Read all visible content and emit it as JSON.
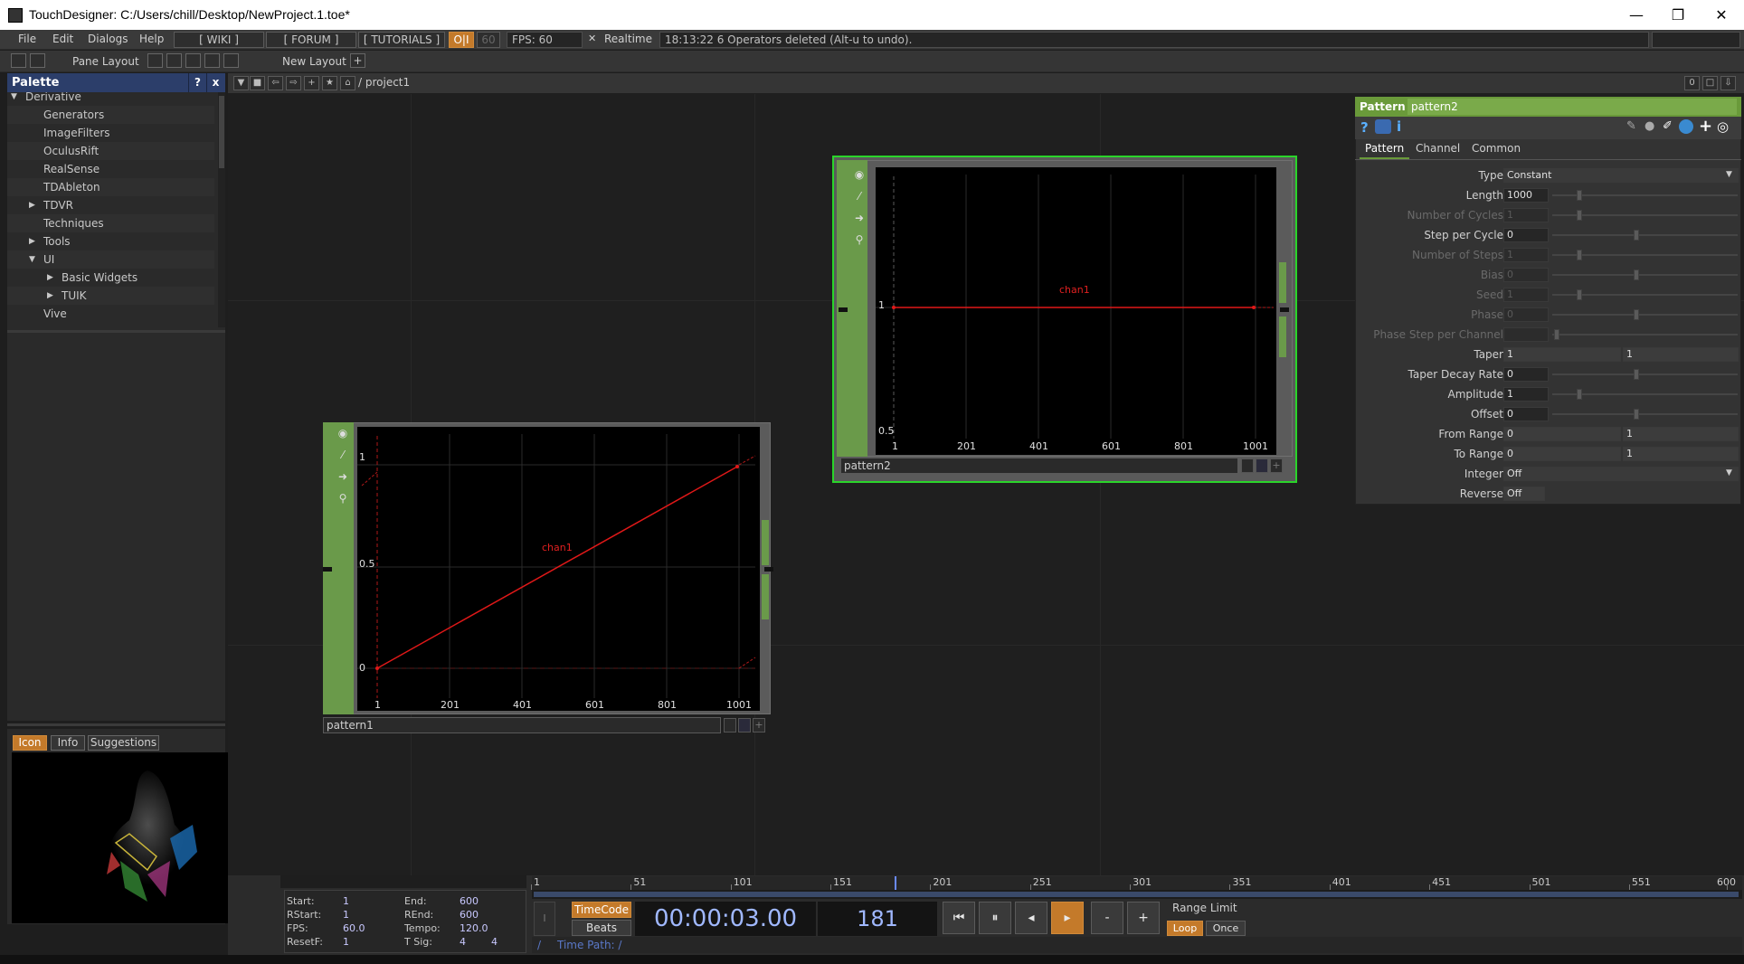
{
  "window": {
    "title": "TouchDesigner: C:/Users/chill/Desktop/NewProject.1.toe*",
    "minimize": "—",
    "maximize": "❐",
    "close": "✕"
  },
  "menubar": {
    "file": "File",
    "edit": "Edit",
    "dialogs": "Dialogs",
    "help": "Help",
    "wiki": "[ WIKI ]",
    "forum": "[ FORUM ]",
    "tutorials": "[ TUTORIALS ]",
    "oi": "O|I",
    "fps_cap": "60",
    "fps": "FPS:  60",
    "realtime_box": "✕",
    "realtime": "Realtime",
    "status": "18:13:22 6 Operators deleted (Alt-u to undo)."
  },
  "panebar": {
    "pane_layout": "Pane Layout",
    "new_layout": "New Layout",
    "add": "+"
  },
  "palette": {
    "title": "Palette",
    "help": "?",
    "close": "x",
    "items": [
      {
        "label": "Derivative",
        "indent": 0,
        "arrow": "▼"
      },
      {
        "label": "Generators",
        "indent": 2,
        "arrow": ""
      },
      {
        "label": "ImageFilters",
        "indent": 2,
        "arrow": ""
      },
      {
        "label": "OculusRift",
        "indent": 2,
        "arrow": ""
      },
      {
        "label": "RealSense",
        "indent": 2,
        "arrow": ""
      },
      {
        "label": "TDAbleton",
        "indent": 2,
        "arrow": ""
      },
      {
        "label": "TDVR",
        "indent": 2,
        "arrow": "▶"
      },
      {
        "label": "Techniques",
        "indent": 2,
        "arrow": ""
      },
      {
        "label": "Tools",
        "indent": 2,
        "arrow": "▶"
      },
      {
        "label": "UI",
        "indent": 2,
        "arrow": "▼"
      },
      {
        "label": "Basic Widgets",
        "indent": 4,
        "arrow": "▶"
      },
      {
        "label": "TUIK",
        "indent": 4,
        "arrow": "▶"
      },
      {
        "label": "Vive",
        "indent": 2,
        "arrow": ""
      }
    ]
  },
  "iconpanel": {
    "tab_icon": "Icon",
    "tab_info": "Info",
    "tab_suggestions": "Suggestions"
  },
  "network": {
    "path": "/ project1",
    "zero": "0"
  },
  "node1": {
    "name": "pattern1",
    "channel": "chan1",
    "x_ticks": [
      "1",
      "201",
      "401",
      "601",
      "801",
      "1001"
    ],
    "y_ticks": [
      "1",
      "0.5",
      "0"
    ]
  },
  "node2": {
    "name": "pattern2",
    "channel": "chan1",
    "x_ticks": [
      "1",
      "201",
      "401",
      "601",
      "801",
      "1001"
    ],
    "y_ticks": [
      "1",
      "0.5"
    ]
  },
  "params": {
    "op_type": "Pattern",
    "op_name": "pattern2",
    "tabs": [
      "Pattern",
      "Channel",
      "Common"
    ],
    "rows": [
      {
        "label": "Type",
        "v1": "Constant",
        "v2": "",
        "dim": false,
        "kind": "menu"
      },
      {
        "label": "Length",
        "v1": "1000",
        "v2": "",
        "dim": false,
        "kind": "slider"
      },
      {
        "label": "Number of Cycles",
        "v1": "1",
        "v2": "",
        "dim": true,
        "kind": "slider"
      },
      {
        "label": "Step per Cycle",
        "v1": "0",
        "v2": "",
        "dim": false,
        "kind": "slider"
      },
      {
        "label": "Number of Steps",
        "v1": "1",
        "v2": "",
        "dim": true,
        "kind": "slider"
      },
      {
        "label": "Bias",
        "v1": "0",
        "v2": "",
        "dim": true,
        "kind": "slider"
      },
      {
        "label": "Seed",
        "v1": "1",
        "v2": "",
        "dim": true,
        "kind": "slider"
      },
      {
        "label": "Phase",
        "v1": "0",
        "v2": "",
        "dim": true,
        "kind": "slider"
      },
      {
        "label": "Phase Step per Channel",
        "v1": "",
        "v2": "",
        "dim": true,
        "kind": "slider"
      },
      {
        "label": "Taper",
        "v1": "1",
        "v2": "1",
        "dim": false,
        "kind": "pair"
      },
      {
        "label": "Taper Decay Rate",
        "v1": "0",
        "v2": "",
        "dim": false,
        "kind": "slider"
      },
      {
        "label": "Amplitude",
        "v1": "1",
        "v2": "",
        "dim": false,
        "kind": "slider"
      },
      {
        "label": "Offset",
        "v1": "0",
        "v2": "",
        "dim": false,
        "kind": "slider"
      },
      {
        "label": "From Range",
        "v1": "0",
        "v2": "1",
        "dim": false,
        "kind": "pair"
      },
      {
        "label": "To Range",
        "v1": "0",
        "v2": "1",
        "dim": false,
        "kind": "pair"
      },
      {
        "label": "Integer",
        "v1": "Off",
        "v2": "",
        "dim": false,
        "kind": "menu"
      },
      {
        "label": "Reverse",
        "v1": "Off",
        "v2": "",
        "dim": false,
        "kind": "toggle"
      }
    ]
  },
  "timeline": {
    "start_lbl": "Start:",
    "start": "1",
    "end_lbl": "End:",
    "end": "600",
    "rstart_lbl": "RStart:",
    "rstart": "1",
    "rend_lbl": "REnd:",
    "rend": "600",
    "fps_lbl": "FPS:",
    "fps": "60.0",
    "tempo_lbl": "Tempo:",
    "tempo": "120.0",
    "resetf_lbl": "ResetF:",
    "resetf": "1",
    "tsig_lbl": "T Sig:",
    "tsig_a": "4",
    "tsig_b": "4",
    "ruler": [
      "1",
      "51",
      "101",
      "151",
      "201",
      "251",
      "301",
      "351",
      "401",
      "451",
      "501",
      "551",
      "600"
    ],
    "timecode_btn": "TimeCode",
    "beats_btn": "Beats",
    "timecode": "00:00:03.00",
    "frame": "181",
    "btn_start": "⏮",
    "btn_pause": "⏸",
    "btn_back": "◂",
    "btn_play": "▸",
    "btn_minus": "-",
    "btn_plus": "+",
    "range_limit": "Range Limit",
    "loop": "Loop",
    "once": "Once",
    "time_path": "Time Path: /",
    "slash": "/",
    "i": "I"
  }
}
